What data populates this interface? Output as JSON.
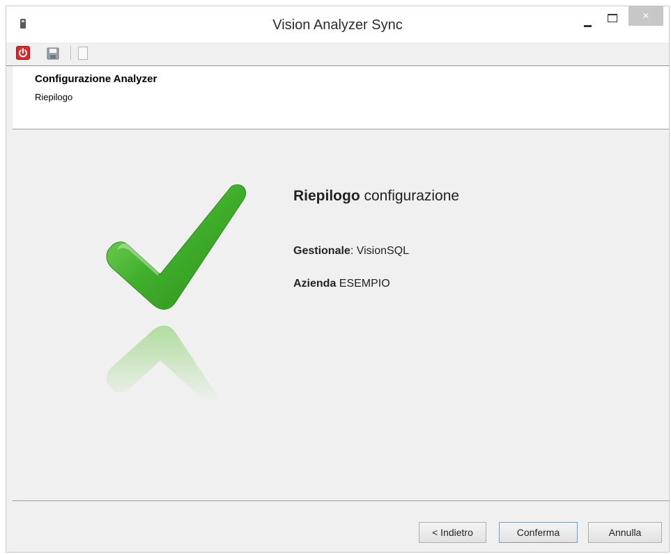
{
  "window": {
    "title": "Vision Analyzer Sync",
    "close_glyph": "×",
    "icons": [
      "app-icon",
      "minimize-icon",
      "maximize-icon",
      "close-icon"
    ]
  },
  "toolbar": {
    "icons": [
      "power-icon",
      "save-icon",
      "page-icon"
    ],
    "accent": "#d92a2a"
  },
  "header": {
    "title": "Configurazione Analyzer",
    "subtitle": "Riepilogo"
  },
  "summary": {
    "title_bold": "Riepilogo",
    "title_rest": " configurazione",
    "gestionale_label": "Gestionale",
    "gestionale_value": ": VisionSQL",
    "azienda_label": "Azienda",
    "azienda_value": " ESEMPIO",
    "check_icon": "checkmark-icon",
    "check_color": "#3fae2a"
  },
  "buttons": {
    "back": "< Indietro",
    "confirm": "Conferma",
    "cancel": "Annulla"
  }
}
